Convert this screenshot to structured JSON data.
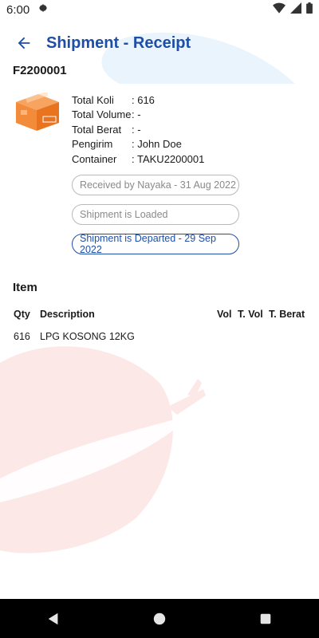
{
  "status_bar": {
    "time": "6:00",
    "icons": [
      "settings-icon",
      "wifi-icon",
      "signal-icon",
      "battery-icon"
    ]
  },
  "header": {
    "title": "Shipment - Receipt",
    "back_icon": "back-arrow-icon"
  },
  "receipt": {
    "id": "F2200001",
    "icon": "package-box-icon",
    "details": [
      {
        "label": "Total Koli",
        "value": ": 616"
      },
      {
        "label": "Total Volume",
        "value": ": -"
      },
      {
        "label": "Total Berat",
        "value": ": -"
      },
      {
        "label": "Pengirim",
        "value": ": John Doe"
      },
      {
        "label": "Container",
        "value": ": TAKU2200001"
      }
    ],
    "statuses": [
      {
        "text": "Received by Nayaka - 31 Aug 2022",
        "active": false
      },
      {
        "text": "Shipment is Loaded",
        "active": false
      },
      {
        "text": "Shipment is Departed - 29 Sep 2022",
        "active": true
      }
    ]
  },
  "items": {
    "title": "Item",
    "columns": [
      "Qty",
      "Description",
      "Vol",
      "T. Vol",
      "T. Berat"
    ],
    "rows": [
      {
        "qty": "616",
        "description": "LPG KOSONG 12KG",
        "vol": "",
        "t_vol": "",
        "t_berat": ""
      }
    ]
  },
  "colors": {
    "primary": "#1d4fa8",
    "pill_inactive": "#8a8a8a",
    "box_orange": "#f28b3a",
    "background_wave_blue": "#eaf4fd",
    "background_watermark_red": "#fde7e7"
  },
  "nav_bar": {
    "icons": [
      "back-triangle-icon",
      "home-circle-icon",
      "recents-square-icon"
    ]
  }
}
